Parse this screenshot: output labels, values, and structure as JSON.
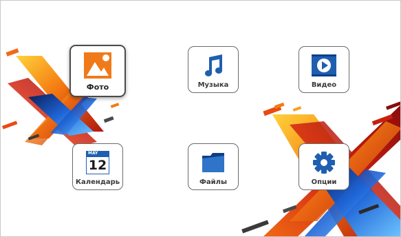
{
  "screen": {
    "accent": "#1f5fb0",
    "photo_color": "#f07a1a"
  },
  "tiles": {
    "photo": {
      "label": "Фото"
    },
    "music": {
      "label": "Музыка"
    },
    "video": {
      "label": "Видео"
    },
    "calendar": {
      "label": "Календарь",
      "month": "MAY",
      "day": "12"
    },
    "files": {
      "label": "Файлы"
    },
    "options": {
      "label": "Опции"
    }
  }
}
